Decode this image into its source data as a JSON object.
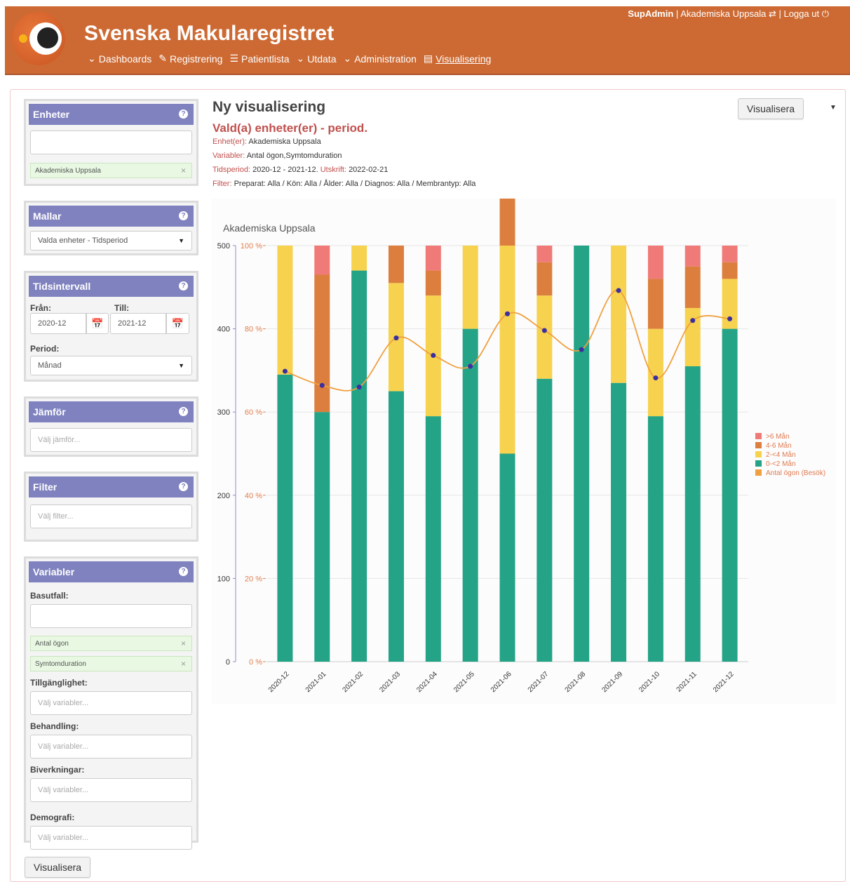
{
  "header": {
    "brand": "Svenska Makularegistret",
    "user": "SupAdmin",
    "unit": "Akademiska Uppsala",
    "logout": "Logga ut",
    "nav": [
      {
        "icon": "chevron-down-icon",
        "label": "Dashboards"
      },
      {
        "icon": "edit-icon",
        "label": "Registrering"
      },
      {
        "icon": "list-icon",
        "label": "Patientlista"
      },
      {
        "icon": "chevron-down-icon",
        "label": "Utdata"
      },
      {
        "icon": "chevron-down-icon",
        "label": "Administration"
      },
      {
        "icon": "chart-icon",
        "label": "Visualisering"
      }
    ]
  },
  "sidebar": {
    "enheter": {
      "title": "Enheter",
      "selected": "Akademiska Uppsala"
    },
    "mallar": {
      "title": "Mallar",
      "value": "Valda enheter - Tidsperiod"
    },
    "tidsintervall": {
      "title": "Tidsintervall",
      "from_label": "Från:",
      "from_value": "2020-12",
      "to_label": "Till:",
      "to_value": "2021-12",
      "period_label": "Period:",
      "period_value": "Månad"
    },
    "jamfor": {
      "title": "Jämför",
      "placeholder": "Välj jämför..."
    },
    "filter": {
      "title": "Filter",
      "placeholder": "Välj filter..."
    },
    "variabler": {
      "title": "Variabler",
      "basutfall_label": "Basutfall:",
      "tags": [
        "Antal ögon",
        "Symtomduration"
      ],
      "tillganglighet_label": "Tillgänglighet:",
      "behandling_label": "Behandling:",
      "biverkningar_label": "Biverkningar:",
      "demografi_label": "Demografi:",
      "placeholder": "Välj variabler..."
    },
    "button": "Visualisera"
  },
  "main": {
    "title": "Ny visualisering",
    "subtitle": "Vald(a) enheter(er) - period.",
    "enheter_key": "Enhet(er):",
    "enheter_val": "Akademiska Uppsala",
    "variabler_key": "Variabler:",
    "variabler_val": "Antal ögon,Symtomduration",
    "tidsperiod_key": "Tidsperiod:",
    "tidsperiod_val": "2020-12 - 2021-12.",
    "utskrift_key": "Utskrift:",
    "utskrift_val": "2022-02-21",
    "filter_key": "Filter:",
    "filter_val": "Preparat: Alla / Kön: Alla / Ålder: Alla / Diagnos: Alla / Membrantyp: Alla",
    "button": "Visualisera"
  },
  "chart_data": {
    "type": "bar",
    "title": "Akademiska Uppsala",
    "categories": [
      "2020-12",
      "2021-01",
      "2021-02",
      "2021-03",
      "2021-04",
      "2021-05",
      "2021-06",
      "2021-07",
      "2021-08",
      "2021-09",
      "2021-10",
      "2021-11",
      "2021-12"
    ],
    "left_axis": {
      "ticks": [
        0,
        100,
        200,
        300,
        400,
        500
      ],
      "range": [
        0,
        500
      ]
    },
    "right_axis": {
      "ticks": [
        "0 %",
        "20 %",
        "40 %",
        "60 %",
        "80 %",
        "100 %"
      ],
      "range": [
        0,
        100
      ]
    },
    "series": [
      {
        "name": "0-<2 Mån",
        "color": "#24a387",
        "values": [
          69,
          60,
          94,
          65,
          59,
          80,
          50,
          68,
          100,
          67,
          59,
          71,
          80
        ]
      },
      {
        "name": "2-<4 Mån",
        "color": "#f6d24f",
        "values": [
          31,
          0,
          6,
          26,
          29,
          20,
          50,
          20,
          0,
          33,
          21,
          14,
          12
        ]
      },
      {
        "name": "4-6 Mån",
        "color": "#dc7f3e",
        "values": [
          0,
          33,
          0,
          9,
          6,
          0,
          12,
          8,
          0,
          0,
          12,
          10,
          4
        ]
      },
      {
        "name": ">6 Mån",
        "color": "#ef7a78",
        "values": [
          0,
          7,
          0,
          0,
          6,
          0,
          4,
          4,
          0,
          0,
          8,
          5,
          4
        ]
      }
    ],
    "line": {
      "name": "Antal ögon (Besök)",
      "color": "#f0a040",
      "values": [
        349,
        332,
        330,
        389,
        368,
        355,
        418,
        398,
        375,
        446,
        341,
        410,
        412
      ]
    },
    "legend": "right",
    "grid": true
  }
}
